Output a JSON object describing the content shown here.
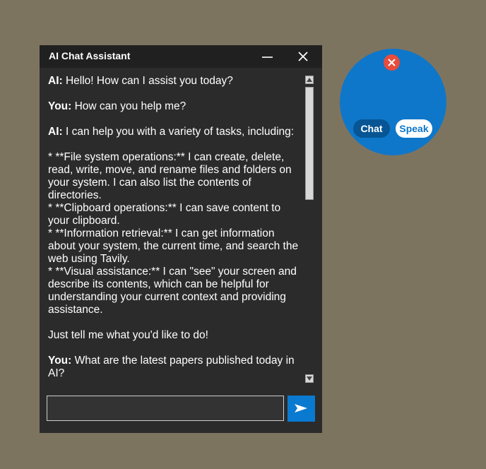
{
  "window": {
    "title": "AI Chat Assistant"
  },
  "messages": [
    {
      "speaker": "AI:",
      "text": " Hello! How can I assist you today?"
    },
    {
      "speaker": "You:",
      "text": " How can you help me?"
    },
    {
      "speaker": "AI:",
      "text": " I can help you with a variety of tasks, including:"
    },
    {
      "speaker": "",
      "text": "* **File system operations:** I can create, delete, read, write, move, and rename files and folders on your system. I can also list the contents of directories.\n* **Clipboard operations:** I can save content to your clipboard.\n* **Information retrieval:** I can get information about your system, the current time, and search the web using Tavily.\n* **Visual assistance:** I can \"see\" your screen and describe its contents, which can be helpful for understanding your current context and providing assistance."
    },
    {
      "speaker": "",
      "text": "Just tell me what you'd like to do!"
    },
    {
      "speaker": "You:",
      "text": " What are the latest papers published today in AI?"
    }
  ],
  "input": {
    "value": "",
    "placeholder": ""
  },
  "bubble": {
    "chat_label": "Chat",
    "speak_label": "Speak"
  },
  "icons": {
    "minimize": "minimize-icon",
    "close": "close-icon",
    "send": "send-arrow-icon",
    "bubble_close": "close-circle-icon"
  },
  "colors": {
    "window_bg": "#2b2b2b",
    "titlebar_bg": "#202020",
    "accent_blue": "#0e77c9",
    "send_button": "#0a79d0",
    "close_red": "#e84c3d",
    "desktop_bg": "#7d7460"
  }
}
